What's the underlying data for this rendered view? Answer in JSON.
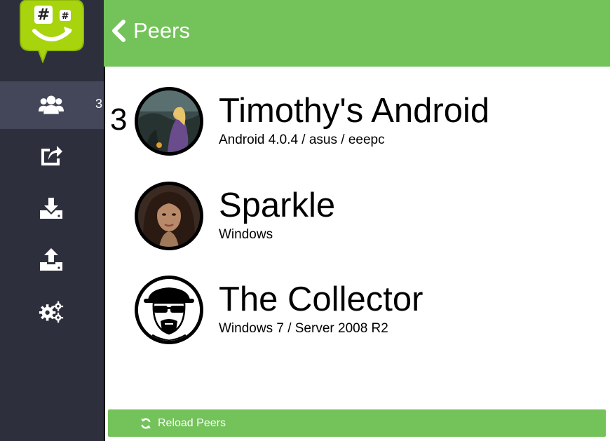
{
  "header": {
    "title": "Peers",
    "back_icon": "chevron-left-icon"
  },
  "sidebar": {
    "items": [
      {
        "name": "peers",
        "icon": "users-icon",
        "active": true,
        "badge": "3"
      },
      {
        "name": "share",
        "icon": "share-icon",
        "active": false
      },
      {
        "name": "download",
        "icon": "download-icon",
        "active": false
      },
      {
        "name": "upload",
        "icon": "upload-icon",
        "active": false
      },
      {
        "name": "settings",
        "icon": "cogs-icon",
        "active": false
      }
    ]
  },
  "peers": {
    "count": "3",
    "items": [
      {
        "name": "Timothy's Android",
        "detail": "Android 4.0.4 / asus / eeepc"
      },
      {
        "name": "Sparkle",
        "detail": "Windows"
      },
      {
        "name": "The Collector",
        "detail": "Windows 7 / Server 2008 R2"
      }
    ]
  },
  "reload": {
    "label": "Reload Peers",
    "icon": "refresh-icon"
  },
  "colors": {
    "accent": "#73c25a",
    "sidebar": "#2e2f3d",
    "sidebar_active": "#44465a",
    "logo": "#a8d40e"
  }
}
